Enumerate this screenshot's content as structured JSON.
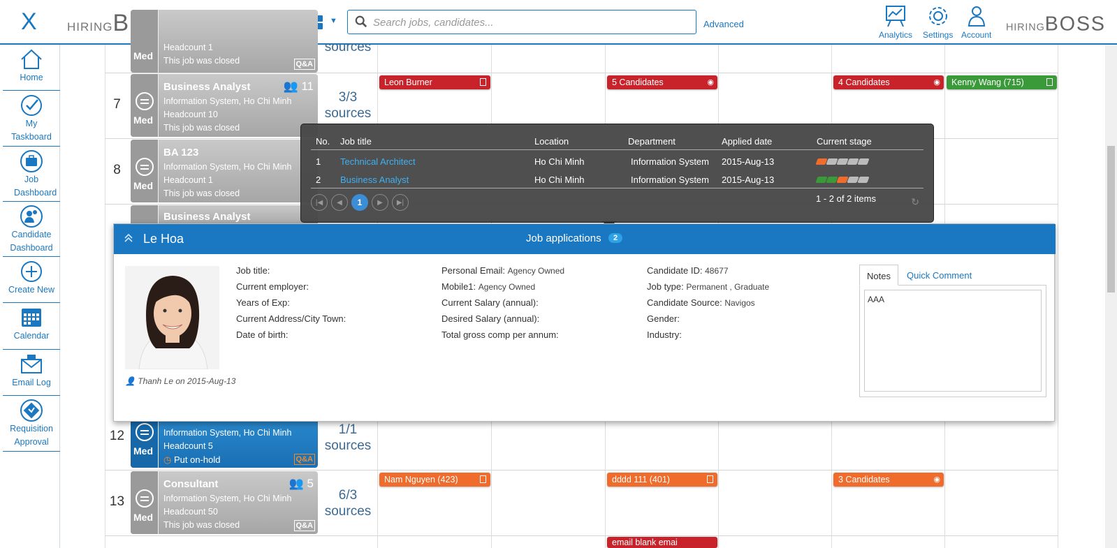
{
  "app": {
    "logo_small": "HIRING",
    "logo_big": "BOSS",
    "close_glyph": "X"
  },
  "search": {
    "placeholder": "Search jobs, candidates...",
    "advanced": "Advanced"
  },
  "topnav": [
    {
      "label": "Analytics",
      "icon": "analytics-icon"
    },
    {
      "label": "Settings",
      "icon": "gear-icon"
    },
    {
      "label": "Account",
      "icon": "user-icon"
    }
  ],
  "sidebar": [
    {
      "label": "Home",
      "icon": "home-icon"
    },
    {
      "label": "My Taskboard",
      "icon": "check-icon"
    },
    {
      "label": "Job Dashboard",
      "icon": "briefcase-icon"
    },
    {
      "label": "Candidate Dashboard",
      "icon": "candidate-icon"
    },
    {
      "label": "Create New",
      "icon": "plus-icon"
    },
    {
      "label": "Calendar",
      "icon": "calendar-icon"
    },
    {
      "label": "Email Log",
      "icon": "mail-icon"
    },
    {
      "label": "Requisition Approval",
      "icon": "approval-icon"
    }
  ],
  "board": {
    "top_partial": {
      "headcount": "Headcount 1",
      "status": "This job was closed",
      "sources": "sources",
      "priority": "Med",
      "qa": "Q&A"
    },
    "row7": {
      "num": "7",
      "title": "Business Analyst",
      "count": "11",
      "location": "Information System, Ho Chi Minh",
      "headcount": "Headcount 10",
      "status": "This job was closed",
      "priority": "Med",
      "sources_ratio": "3/3",
      "sources_label": "sources",
      "tag1": "Leon Burner",
      "tag2": "5 Candidates",
      "tag3": "4 Candidates",
      "tag4": "Kenny Wang (715)"
    },
    "row8": {
      "num": "8",
      "title": "BA 123",
      "location": "Information System, Ho Chi Minh",
      "headcount": "Headcount 1",
      "status": "This job was closed",
      "priority": "Med"
    },
    "row9": {
      "title": "Business Analyst"
    },
    "row12": {
      "num": "12",
      "location": "Information System, Ho Chi Minh",
      "headcount": "Headcount 5",
      "status": "Put on-hold",
      "priority": "Med",
      "qa": "Q&A",
      "sources_ratio": "1/1",
      "sources_label": "sources"
    },
    "row13": {
      "num": "13",
      "title": "Consultant",
      "count": "5",
      "location": "Information System, Ho Chi Minh",
      "headcount": "Headcount 50",
      "status": "This job was closed",
      "priority": "Med",
      "qa": "Q&A",
      "sources_ratio": "6/3",
      "sources_label": "sources",
      "tag1": "Nam Nguyen (423)",
      "tag2": "dddd 111 (401)",
      "tag3": "3 Candidates"
    },
    "bottom_tag": "email blank emai"
  },
  "applications_popup": {
    "headers": {
      "no": "No.",
      "title": "Job title",
      "location": "Location",
      "department": "Department",
      "applied": "Applied date",
      "stage": "Current stage"
    },
    "rows": [
      {
        "no": "1",
        "title": "Technical Architect",
        "location": "Ho Chi Minh",
        "department": "Information System",
        "applied": "2015-Aug-13",
        "stage_done": 1,
        "stage_total": 5
      },
      {
        "no": "2",
        "title": "Business Analyst",
        "location": "Ho Chi Minh",
        "department": "Information System",
        "applied": "2015-Aug-13",
        "stage_done": 3,
        "stage_total": 5
      }
    ],
    "page": "1",
    "items_info": "1 - 2 of 2 items"
  },
  "candidate": {
    "name": "Le Hoa",
    "apps_title": "Job applications",
    "apps_count": "2",
    "credit": "Thanh Le on 2015-Aug-13",
    "col1": [
      {
        "label": "Job title:",
        "value": ""
      },
      {
        "label": "Current employer:",
        "value": ""
      },
      {
        "label": "Years of Exp:",
        "value": ""
      },
      {
        "label": "Current Address/City Town:",
        "value": ""
      },
      {
        "label": "Date of birth:",
        "value": ""
      }
    ],
    "col2": [
      {
        "label": "Personal Email:",
        "value": "Agency Owned"
      },
      {
        "label": "Mobile1:",
        "value": "Agency Owned"
      },
      {
        "label": "Current Salary (annual):",
        "value": ""
      },
      {
        "label": "Desired Salary (annual):",
        "value": ""
      },
      {
        "label": "Total gross comp per annum:",
        "value": ""
      }
    ],
    "col3": [
      {
        "label": "Candidate ID:",
        "value": "48677"
      },
      {
        "label": "Job type:",
        "value": "Permanent , Graduate"
      },
      {
        "label": "Candidate Source:",
        "value": "Navigos"
      },
      {
        "label": "Gender:",
        "value": ""
      },
      {
        "label": "Industry:",
        "value": ""
      }
    ],
    "tabs": [
      "Notes",
      "Quick Comment"
    ],
    "notes": "AAA"
  },
  "colors": {
    "brand": "#1a78c2",
    "red": "#c8232b",
    "orange": "#ef6c2c",
    "green": "#3a9a3a"
  }
}
